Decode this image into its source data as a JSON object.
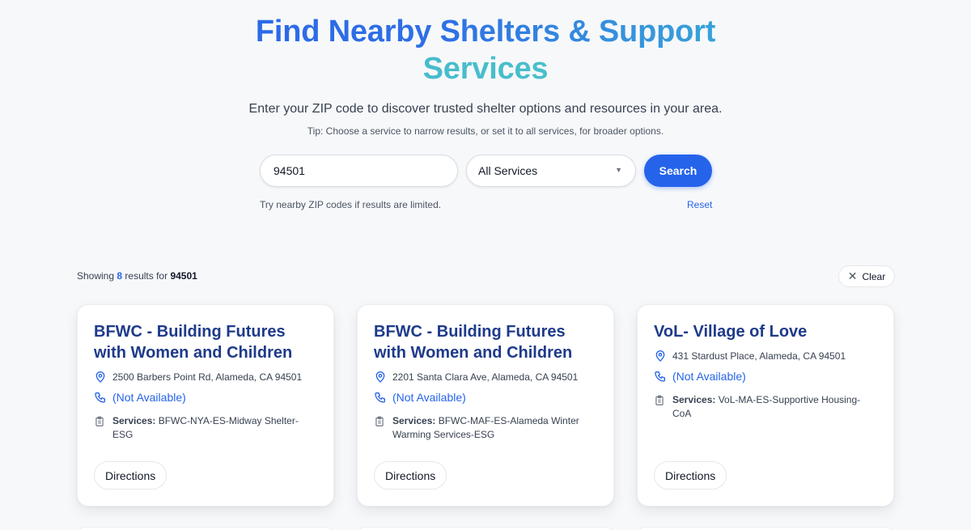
{
  "header": {
    "title_line1": "Find Nearby Shelters & Support",
    "title_line2": "Services",
    "subtitle": "Enter your ZIP code to discover trusted shelter options and resources in your area.",
    "tip": "Tip: Choose a service to narrow results, or set it to all services, for broader options."
  },
  "search": {
    "zip_value": "94501",
    "service_selected": "All Services",
    "search_label": "Search",
    "hint": "Try nearby ZIP codes if results are limited.",
    "reset_label": "Reset"
  },
  "results": {
    "prefix": "Showing",
    "count": "8",
    "middle": "results for",
    "zip": "94501",
    "clear_label": "Clear"
  },
  "cards": [
    {
      "title": "BFWC - Building Futures with Women and Children",
      "address": "2500 Barbers Point Rd, Alameda, CA 94501",
      "phone": "(Not Available)",
      "services_label": "Services:",
      "services": "BFWC-NYA-ES-Midway Shelter-ESG",
      "directions": "Directions"
    },
    {
      "title": "BFWC - Building Futures with Women and Children",
      "address": "2201 Santa Clara Ave, Alameda, CA 94501",
      "phone": "(Not Available)",
      "services_label": "Services:",
      "services": "BFWC-MAF-ES-Alameda Winter Warming Services-ESG",
      "directions": "Directions"
    },
    {
      "title": "VoL- Village of Love",
      "address": "431 Stardust Place, Alameda, CA 94501",
      "phone": "(Not Available)",
      "services_label": "Services:",
      "services": "VoL-MA-ES-Supportive Housing-CoA",
      "directions": "Directions"
    }
  ],
  "icons": {
    "location": "map-pin-icon",
    "phone": "phone-icon",
    "services": "clipboard-icon",
    "clear": "close-icon",
    "select": "chevron-down-icon"
  },
  "colors": {
    "accent": "#2563eb",
    "card_title": "#1e3a8a",
    "gradient_end": "#4fc9c2"
  }
}
